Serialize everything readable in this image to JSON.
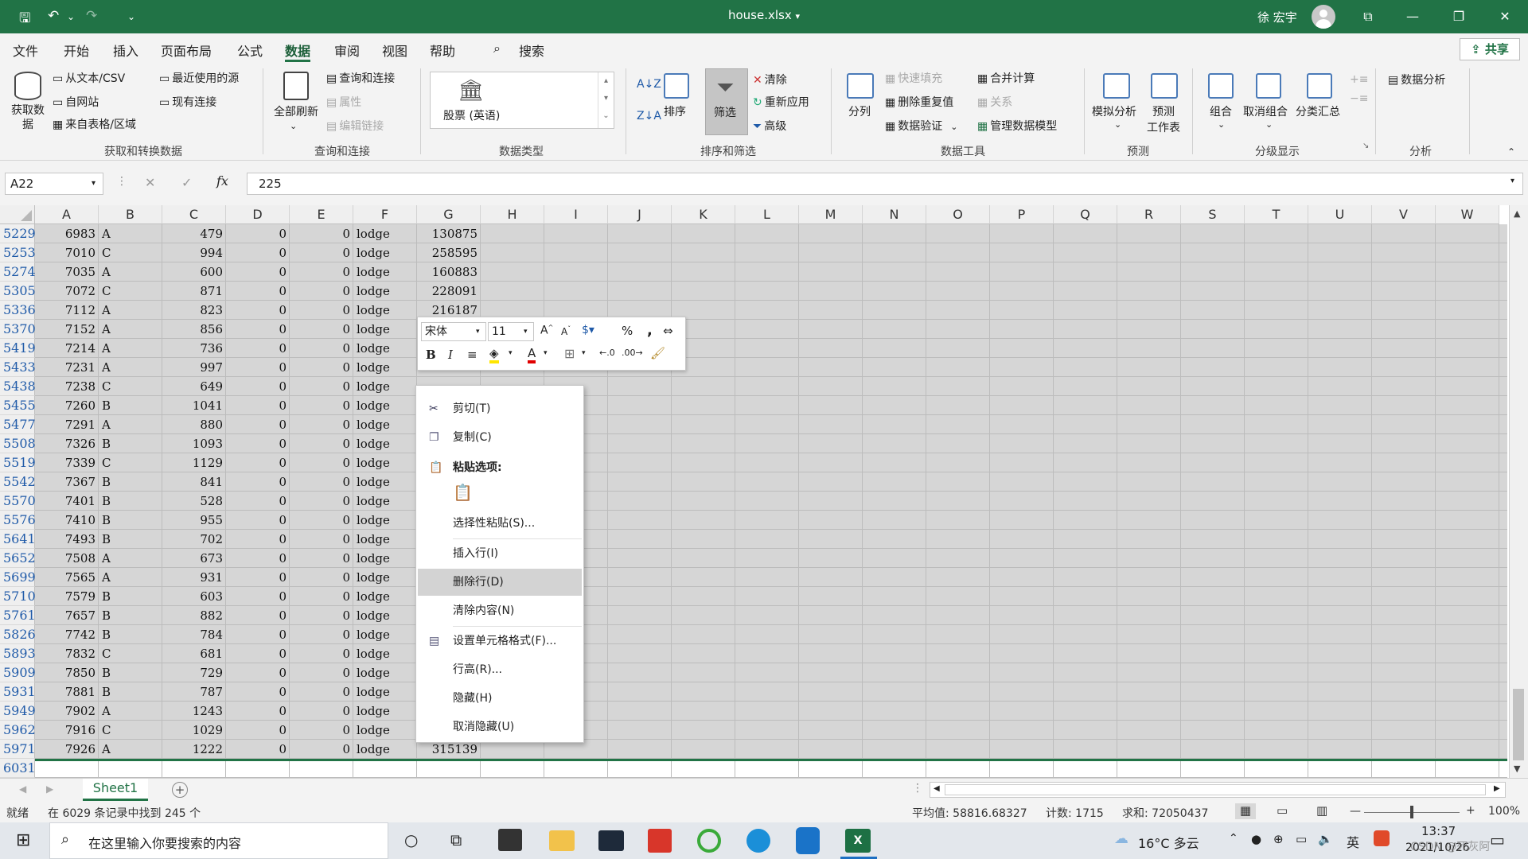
{
  "app": {
    "file_title": "house.xlsx",
    "title_caret": "▾",
    "user_name": "徐 宏宇",
    "accent": "#217346"
  },
  "quick_access": {
    "save": "🖫",
    "undo": "↶",
    "redo": "↷",
    "customize": "⌄"
  },
  "window": {
    "ribbon_display": "⧉",
    "minimize": "—",
    "restore": "❐",
    "close": "✕"
  },
  "menu": {
    "tabs": [
      "文件",
      "开始",
      "插入",
      "页面布局",
      "公式",
      "数据",
      "审阅",
      "视图",
      "帮助"
    ],
    "active": "数据",
    "search": "搜索",
    "share": "共享"
  },
  "ribbon": {
    "get_data": {
      "big_button": "获取数据",
      "items": [
        "从文本/CSV",
        "自网站",
        "来自表格/区域",
        "最近使用的源",
        "现有连接"
      ],
      "label": "获取和转换数据"
    },
    "queries": {
      "big_button": "全部刷新",
      "items": [
        "查询和连接",
        "属性",
        "编辑链接"
      ],
      "label": "查询和连接"
    },
    "data_types": {
      "stock": "股票 (英语)",
      "label": "数据类型"
    },
    "sort_filter": {
      "sort": "排序",
      "filter": "筛选",
      "items": [
        "清除",
        "重新应用",
        "高级"
      ],
      "label": "排序和筛选"
    },
    "data_tools": {
      "split": "分列",
      "items": [
        "快速填充",
        "删除重复值",
        "数据验证",
        "合并计算",
        "关系",
        "管理数据模型"
      ],
      "label": "数据工具"
    },
    "forecast": {
      "whatif": "模拟分析",
      "sheet_a": "预测",
      "sheet_b": "工作表",
      "label": "预测"
    },
    "outline": {
      "group": "组合",
      "ungroup": "取消组合",
      "subtotal": "分类汇总",
      "label": "分级显示"
    },
    "analysis": {
      "item": "数据分析",
      "label": "分析"
    }
  },
  "formula_bar": {
    "name_box": "A22",
    "cancel": "✕",
    "enter": "✓",
    "fx": "fx",
    "value": "225"
  },
  "columns": [
    "A",
    "B",
    "C",
    "D",
    "E",
    "F",
    "G",
    "H",
    "I",
    "J",
    "K",
    "L",
    "M",
    "N",
    "O",
    "P",
    "Q",
    "R",
    "S",
    "T",
    "U",
    "V",
    "W"
  ],
  "rows": [
    {
      "row": "5229",
      "a": "6983",
      "b": "A",
      "c": "479",
      "d": "0",
      "e": "0",
      "f": "lodge",
      "g": "130875"
    },
    {
      "row": "5253",
      "a": "7010",
      "b": "C",
      "c": "994",
      "d": "0",
      "e": "0",
      "f": "lodge",
      "g": "258595"
    },
    {
      "row": "5274",
      "a": "7035",
      "b": "A",
      "c": "600",
      "d": "0",
      "e": "0",
      "f": "lodge",
      "g": "160883"
    },
    {
      "row": "5305",
      "a": "7072",
      "b": "C",
      "c": "871",
      "d": "0",
      "e": "0",
      "f": "lodge",
      "g": "228091"
    },
    {
      "row": "5336",
      "a": "7112",
      "b": "A",
      "c": "823",
      "d": "0",
      "e": "0",
      "f": "lodge",
      "g": "216187"
    },
    {
      "row": "5370",
      "a": "7152",
      "b": "A",
      "c": "856",
      "d": "0",
      "e": "0",
      "f": "lodge",
      "g": ""
    },
    {
      "row": "5419",
      "a": "7214",
      "b": "A",
      "c": "736",
      "d": "0",
      "e": "0",
      "f": "lodge",
      "g": ""
    },
    {
      "row": "5433",
      "a": "7231",
      "b": "A",
      "c": "997",
      "d": "0",
      "e": "0",
      "f": "lodge",
      "g": ""
    },
    {
      "row": "5438",
      "a": "7238",
      "b": "C",
      "c": "649",
      "d": "0",
      "e": "0",
      "f": "lodge",
      "g": ""
    },
    {
      "row": "5455",
      "a": "7260",
      "b": "B",
      "c": "1041",
      "d": "0",
      "e": "0",
      "f": "lodge",
      "g": ""
    },
    {
      "row": "5477",
      "a": "7291",
      "b": "A",
      "c": "880",
      "d": "0",
      "e": "0",
      "f": "lodge",
      "g": ""
    },
    {
      "row": "5508",
      "a": "7326",
      "b": "B",
      "c": "1093",
      "d": "0",
      "e": "0",
      "f": "lodge",
      "g": ""
    },
    {
      "row": "5519",
      "a": "7339",
      "b": "C",
      "c": "1129",
      "d": "0",
      "e": "0",
      "f": "lodge",
      "g": ""
    },
    {
      "row": "5542",
      "a": "7367",
      "b": "B",
      "c": "841",
      "d": "0",
      "e": "0",
      "f": "lodge",
      "g": ""
    },
    {
      "row": "5570",
      "a": "7401",
      "b": "B",
      "c": "528",
      "d": "0",
      "e": "0",
      "f": "lodge",
      "g": ""
    },
    {
      "row": "5576",
      "a": "7410",
      "b": "B",
      "c": "955",
      "d": "0",
      "e": "0",
      "f": "lodge",
      "g": ""
    },
    {
      "row": "5641",
      "a": "7493",
      "b": "B",
      "c": "702",
      "d": "0",
      "e": "0",
      "f": "lodge",
      "g": ""
    },
    {
      "row": "5652",
      "a": "7508",
      "b": "A",
      "c": "673",
      "d": "0",
      "e": "0",
      "f": "lodge",
      "g": ""
    },
    {
      "row": "5699",
      "a": "7565",
      "b": "A",
      "c": "931",
      "d": "0",
      "e": "0",
      "f": "lodge",
      "g": ""
    },
    {
      "row": "5710",
      "a": "7579",
      "b": "B",
      "c": "603",
      "d": "0",
      "e": "0",
      "f": "lodge",
      "g": ""
    },
    {
      "row": "5761",
      "a": "7657",
      "b": "B",
      "c": "882",
      "d": "0",
      "e": "0",
      "f": "lodge",
      "g": ""
    },
    {
      "row": "5826",
      "a": "7742",
      "b": "B",
      "c": "784",
      "d": "0",
      "e": "0",
      "f": "lodge",
      "g": ""
    },
    {
      "row": "5893",
      "a": "7832",
      "b": "C",
      "c": "681",
      "d": "0",
      "e": "0",
      "f": "lodge",
      "g": ""
    },
    {
      "row": "5909",
      "a": "7850",
      "b": "B",
      "c": "729",
      "d": "0",
      "e": "0",
      "f": "lodge",
      "g": ""
    },
    {
      "row": "5931",
      "a": "7881",
      "b": "B",
      "c": "787",
      "d": "0",
      "e": "0",
      "f": "lodge",
      "g": ""
    },
    {
      "row": "5949",
      "a": "7902",
      "b": "A",
      "c": "1243",
      "d": "0",
      "e": "0",
      "f": "lodge",
      "g": ""
    },
    {
      "row": "5962",
      "a": "7916",
      "b": "C",
      "c": "1029",
      "d": "0",
      "e": "0",
      "f": "lodge",
      "g": ""
    },
    {
      "row": "5971",
      "a": "7926",
      "b": "A",
      "c": "1222",
      "d": "0",
      "e": "0",
      "f": "lodge",
      "g": "315139"
    },
    {
      "row": "6031",
      "a": "",
      "b": "",
      "c": "",
      "d": "",
      "e": "",
      "f": "",
      "g": ""
    }
  ],
  "mini_toolbar": {
    "font": "宋体",
    "size": "11",
    "bold": "B",
    "italic": "I",
    "percent": "%",
    "comma": ","
  },
  "context_menu": {
    "items": [
      {
        "label": "剪切(T)",
        "icon": "scissors-icon"
      },
      {
        "label": "复制(C)",
        "icon": "copy-icon"
      },
      {
        "label": "粘贴选项:",
        "icon": "paste-icon"
      },
      {
        "label": "选择性粘贴(S)..."
      },
      {
        "label": "插入行(I)"
      },
      {
        "label": "删除行(D)"
      },
      {
        "label": "清除内容(N)"
      },
      {
        "label": "设置单元格格式(F)...",
        "icon": "format-cells-icon"
      },
      {
        "label": "行高(R)..."
      },
      {
        "label": "隐藏(H)"
      },
      {
        "label": "取消隐藏(U)"
      }
    ],
    "highlighted": "删除行(D)"
  },
  "sheets": {
    "active": "Sheet1",
    "add": "+"
  },
  "status": {
    "ready": "就绪",
    "filter_info": "在 6029 条记录中找到 245 个",
    "average": "平均值: 58816.68327",
    "count": "计数: 1715",
    "sum": "求和: 72050437",
    "zoom": "100%",
    "minus": "—",
    "plus": "+"
  },
  "taskbar": {
    "search_placeholder": "在这里输入你要搜索的内容",
    "weather": "16°C 多云",
    "ime": "英",
    "time": "13:37",
    "date": "2021/10/26",
    "watermark": "CSDN @死灰阿"
  }
}
